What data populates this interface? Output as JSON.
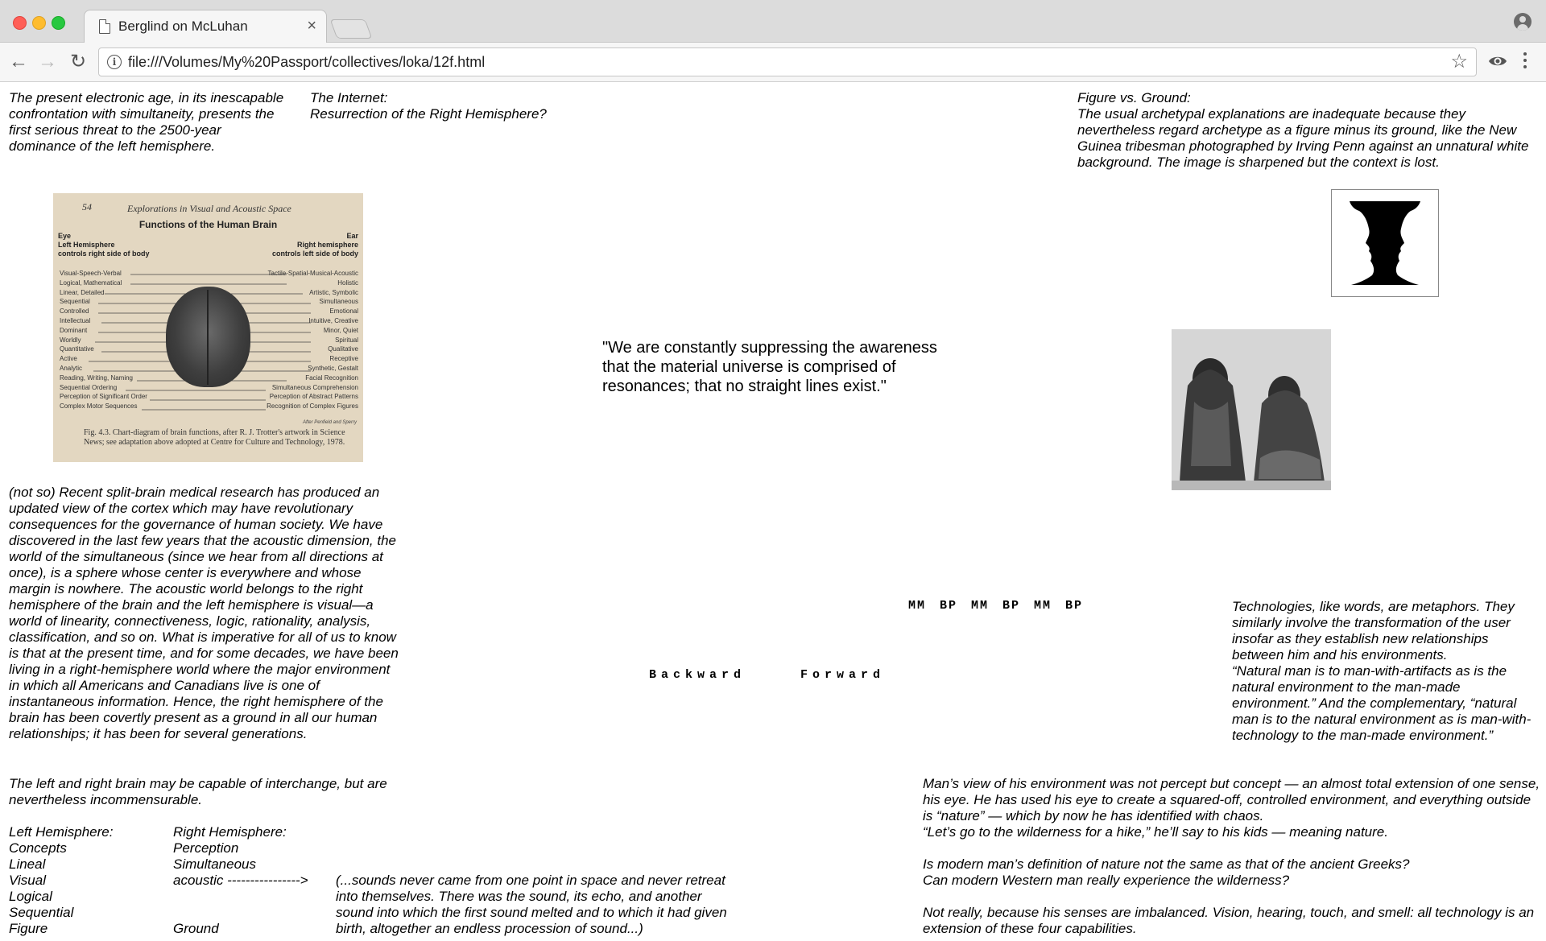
{
  "browser": {
    "tab_title": "Berglind on McLuhan",
    "tab_close": "×",
    "url": "file:///Volumes/My%20Passport/collectives/loka/12f.html",
    "back_glyph": "←",
    "forward_glyph": "→",
    "reload_glyph": "↻",
    "bookmark_glyph": "☆",
    "info_glyph": "i"
  },
  "icons": [
    "document-icon",
    "close-icon",
    "account-icon",
    "back-icon",
    "forward-icon",
    "reload-icon",
    "info-icon",
    "bookmark-star-icon",
    "eye-icon",
    "menu-icon"
  ],
  "colors": {
    "close": "#ff5f57",
    "minimize": "#febc2e",
    "zoom": "#28c840"
  },
  "page": {
    "intro": "The present electronic age, in its inescapable confrontation with simultaneity, presents the first serious threat to the 2500-year dominance of the left hemisphere.",
    "internet_heading": "The Internet:\nResurrection of the Right Hemisphere?",
    "figure_ground": "Figure vs. Ground:\nThe usual archetypal explanations are inadequate because they nevertheless regard archetype as a figure minus its ground, like the New Guinea tribesman photographed by Irving Penn against an unnatural white background. The image is sharpened but the context is lost.",
    "quote": "\"We are constantly suppressing the awareness that the material universe is comprised of resonances; that no straight lines exist.\"",
    "split_brain": "(not so) Recent split-brain medical research has produced an updated view of the cortex which may have revolutionary consequences for the governance of human society. We have discovered in the last few years that the acoustic dimension, the world of the simultaneous (since we hear from all directions at once), is a sphere whose center is everywhere and whose margin is nowhere. The acoustic world belongs to the right hemisphere of the brain and the left hemisphere is visual—a world of linearity, connectiveness, logic, rationality, analysis, classification, and so on. What is imperative for all of us to know is that at the present time, and for some decades, we have been living in a right-hemisphere world where the major environment in which all Americans and Canadians live is one of instantaneous information. Hence, the right hemisphere of the brain has been covertly present as a ground in all our human relationships; it has been for several generations.",
    "mmbp": "MM BP MM BP MM BP",
    "backward": "Backward",
    "forward": "Forward",
    "technologies": "Technologies, like words, are metaphors. They similarly involve the transformation of the user insofar as they establish new relationships between him and his environments.\n“Natural man is to man-with-artifacts as is the natural environment to the man-made environment.” And the complementary, “natural man is to the natural environment as is man-with-technology to the man-made environment.”",
    "incommensurable": "The left and right brain may be capable of interchange, but are nevertheless incommensurable.",
    "left_col": "Left Hemisphere:\nConcepts\nLineal\nVisual\nLogical\nSequential\nFigure",
    "right_col": "Right Hemisphere:\nPerception\nSimultaneous\nacoustic    ---------------->\n\n\nGround",
    "sounds": "(...sounds never came from one point in space and never retreat into themselves. There was the sound, its echo, and another sound into which the first sound melted and to which it had given birth, altogether an endless procession of sound...)",
    "mans_view": "Man’s view of his environment was not percept but concept — an almost total extension of one sense, his eye. He has used his eye to create a squared-off, controlled environment, and everything outside is “nature” — which by now he has identified with chaos.\n“Let’s go to the wilderness for a hike,” he’ll say to his kids — meaning nature.\n\nIs modern man’s definition of nature not the same as that of the ancient Greeks?\nCan modern Western man really experience the wilderness?\n\nNot really, because his senses are imbalanced. Vision, hearing, touch, and smell: all technology is an extension of these four capabilities."
  },
  "brain_chart": {
    "page_number": "54",
    "running_head": "Explorations in Visual and Acoustic Space",
    "title": "Functions of the Human Brain",
    "left_header": "Eye\nLeft Hemisphere\ncontrols right side of body",
    "right_header": "Ear\nRight hemisphere\ncontrols left side of body",
    "left_items": "Visual-Speech-Verbal\nLogical, Mathematical\nLinear, Detailed\nSequential\nControlled\nIntellectual\nDominant\nWorldly\nQuantitative\nActive\nAnalytic\nReading, Writing, Naming\nSequential Ordering\nPerception of Significant Order\nComplex Motor Sequences",
    "right_items": "Tactile-Spatial-Musical-Acoustic\nHolistic\nArtistic, Symbolic\nSimultaneous\nEmotional\nIntuitive, Creative\nMinor, Quiet\nSpiritual\nQualitative\nReceptive\nSynthetic, Gestalt\nFacial Recognition\nSimultaneous Comprehension\nPerception of Abstract Patterns\nRecognition of Complex Figures",
    "credit": "After Penfield and Sperry",
    "caption": "Fig. 4.3. Chart-diagram of brain functions, after R. J. Trotter's artwork in Science News; see adaptation above adopted at Centre for Culture and Technology, 1978."
  }
}
